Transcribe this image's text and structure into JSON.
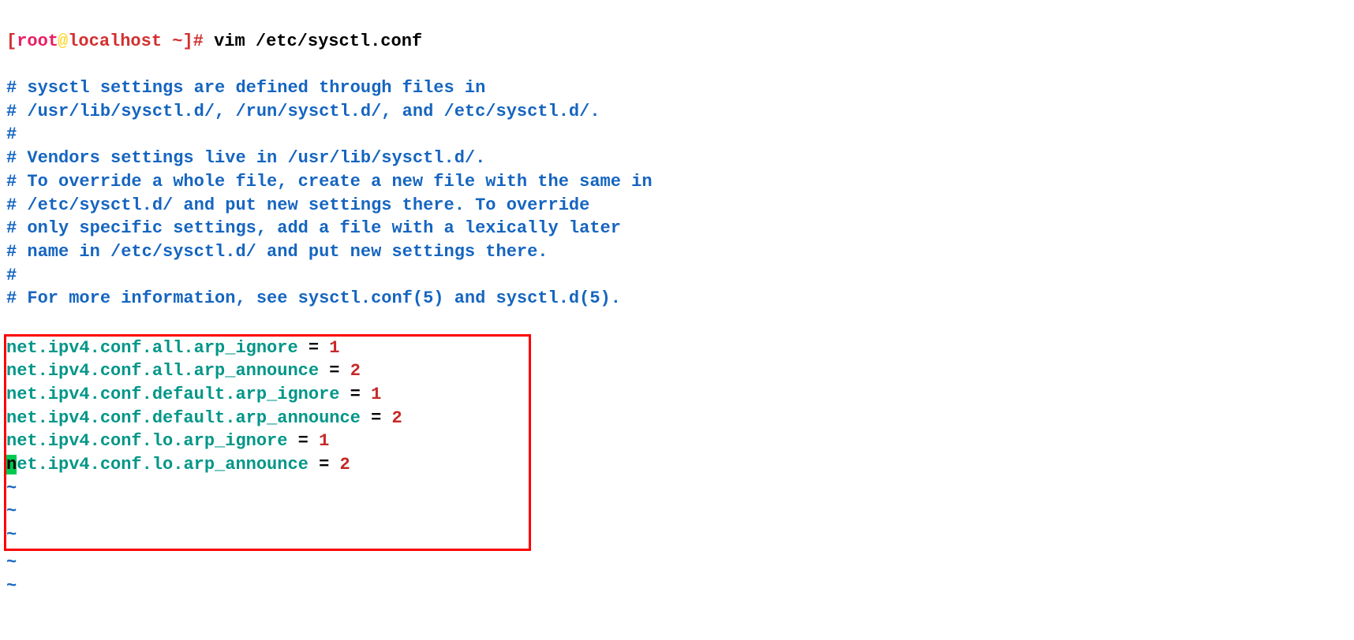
{
  "prompt": {
    "open_bracket": "[",
    "user": "root",
    "at": "@",
    "host": "localhost",
    "path": " ~",
    "close_bracket": "]",
    "hash": "# "
  },
  "command": "vim /etc/sysctl.conf",
  "comments": {
    "l1": "# sysctl settings are defined through files in",
    "l2": "# /usr/lib/sysctl.d/, /run/sysctl.d/, and /etc/sysctl.d/.",
    "l3": "#",
    "l4": "# Vendors settings live in /usr/lib/sysctl.d/.",
    "l5": "# To override a whole file, create a new file with the same in",
    "l6": "# /etc/sysctl.d/ and put new settings there. To override",
    "l7": "# only specific settings, add a file with a lexically later",
    "l8": "# name in /etc/sysctl.d/ and put new settings there.",
    "l9": "#",
    "l10": "# For more information, see sysctl.conf(5) and sysctl.d(5)."
  },
  "conf": {
    "l1key": "net.ipv4.conf.all.arp_ignore",
    "l1eq": " = ",
    "l1val": "1",
    "l2key": "net.ipv4.conf.all.arp_announce",
    "l2eq": " = ",
    "l2val": "2",
    "l3key": "net.ipv4.conf.default.arp_ignore",
    "l3eq": " = ",
    "l3val": "1",
    "l4key": "net.ipv4.conf.default.arp_announce",
    "l4eq": " = ",
    "l4val": "2",
    "l5key": "net.ipv4.conf.lo.arp_ignore",
    "l5eq": " = ",
    "l5val": "1",
    "l6cursor": "n",
    "l6rest": "et.ipv4.conf.lo.arp_announce",
    "l6eq": " = ",
    "l6val": "2"
  },
  "tilde": "~"
}
